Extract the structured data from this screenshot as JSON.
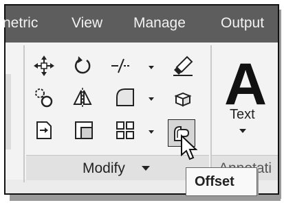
{
  "tabs": {
    "items": [
      "netric",
      "View",
      "Manage",
      "Output"
    ]
  },
  "modify_panel": {
    "label": "Modify",
    "tools": [
      {
        "name": "move",
        "icon": "move-icon"
      },
      {
        "name": "rotate",
        "icon": "rotate-icon"
      },
      {
        "name": "trim",
        "icon": "trim-icon"
      },
      {
        "name": "erase",
        "icon": "erase-icon"
      },
      {
        "name": "copy",
        "icon": "copy-icon"
      },
      {
        "name": "mirror",
        "icon": "mirror-icon"
      },
      {
        "name": "fillet",
        "icon": "fillet-icon"
      },
      {
        "name": "explode",
        "icon": "explode-icon"
      },
      {
        "name": "stretch",
        "icon": "stretch-icon"
      },
      {
        "name": "scale",
        "icon": "scale-icon"
      },
      {
        "name": "array",
        "icon": "array-icon"
      },
      {
        "name": "offset",
        "icon": "offset-icon"
      }
    ]
  },
  "text_tool": {
    "glyph": "A",
    "label": "Text"
  },
  "annotation_panel": {
    "label": "Annotati"
  },
  "tooltip": {
    "label": "Offset"
  },
  "colors": {
    "tab_bar": "#5d5d5d",
    "ribbon": "#f3f3f3",
    "accent": "#222222"
  }
}
